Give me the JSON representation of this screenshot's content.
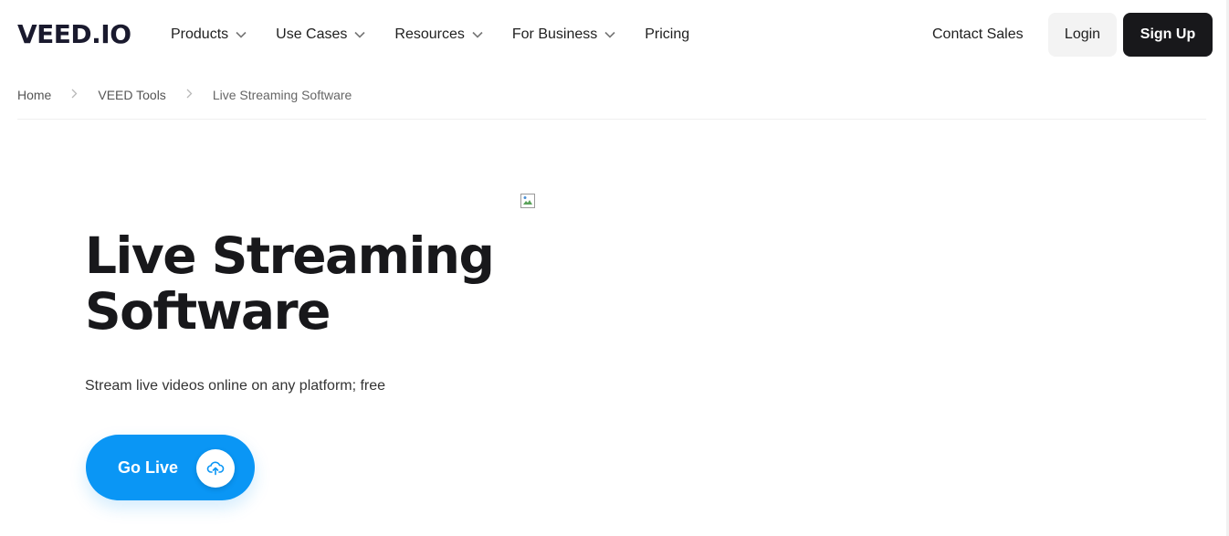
{
  "header": {
    "logo": "VEED.IO",
    "nav": [
      {
        "label": "Products",
        "has_dropdown": true
      },
      {
        "label": "Use Cases",
        "has_dropdown": true
      },
      {
        "label": "Resources",
        "has_dropdown": true
      },
      {
        "label": "For Business",
        "has_dropdown": true
      },
      {
        "label": "Pricing",
        "has_dropdown": false
      }
    ],
    "contact_label": "Contact Sales",
    "login_label": "Login",
    "signup_label": "Sign Up"
  },
  "breadcrumb": {
    "items": [
      "Home",
      "VEED Tools",
      "Live Streaming Software"
    ],
    "separator_icon": "chevron-right-icon"
  },
  "hero": {
    "title": "Live Streaming Software",
    "subtitle": "Stream live videos online on any platform; free",
    "cta_label": "Go Live",
    "cta_icon": "cloud-upload-icon",
    "image_icon": "broken-image-icon"
  },
  "colors": {
    "accent": "#0a96f5",
    "signup_bg": "#18181b",
    "login_bg": "#f3f3f3",
    "text_dark": "#18181b"
  }
}
